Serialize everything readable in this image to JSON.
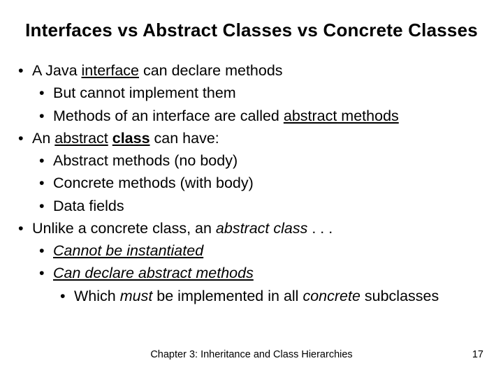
{
  "title": "Interfaces vs Abstract Classes vs Concrete Classes",
  "b1": {
    "pre": "A Java ",
    "u": "interface",
    "post": " can declare methods",
    "s1": "But cannot implement them",
    "s2_pre": "Methods of an interface are called ",
    "s2_u": "abstract methods"
  },
  "b2": {
    "pre": "An ",
    "u1": "abstract",
    "sp": " ",
    "u2": "class",
    "post": " can have:",
    "s1": "Abstract methods (no body)",
    "s2": "Concrete methods (with body)",
    "s3": "Data fields"
  },
  "b3": {
    "pre": "Unlike a concrete class, an ",
    "i": "abstract class",
    "post": " . . .",
    "s1": "Cannot be instantiated",
    "s2": "Can declare abstract methods",
    "s3_pre": "Which ",
    "s3_i": "must",
    "s3_mid": " be implemented in all ",
    "s3_i2": "concrete",
    "s3_post": " subclasses"
  },
  "footer": {
    "text": "Chapter 3: Inheritance and Class Hierarchies",
    "page": "17"
  }
}
